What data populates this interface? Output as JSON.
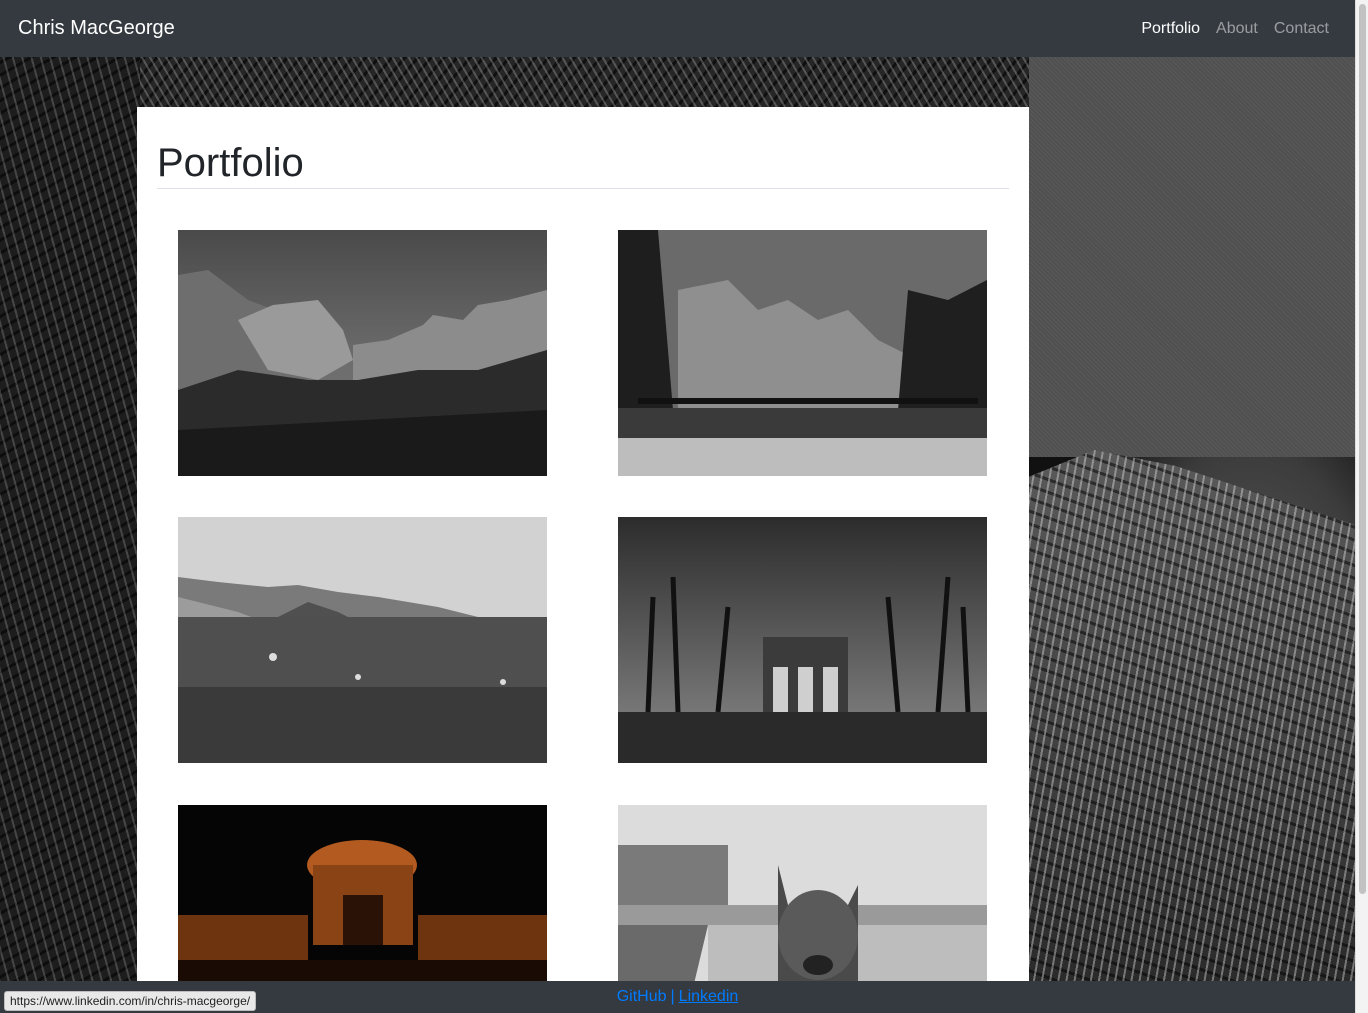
{
  "navbar": {
    "brand": "Chris MacGeorge",
    "links": [
      {
        "label": "Portfolio",
        "active": true
      },
      {
        "label": "About",
        "active": false
      },
      {
        "label": "Contact",
        "active": false
      }
    ]
  },
  "main": {
    "title": "Portfolio"
  },
  "footer": {
    "github": "GitHub",
    "separator": "|",
    "linkedin": "Linkedin"
  },
  "status_url": "https://www.linkedin.com/in/chris-macgeorge/",
  "colors": {
    "navbar_bg": "#343a40",
    "link_color": "#007bff",
    "card_bg": "#ffffff"
  }
}
